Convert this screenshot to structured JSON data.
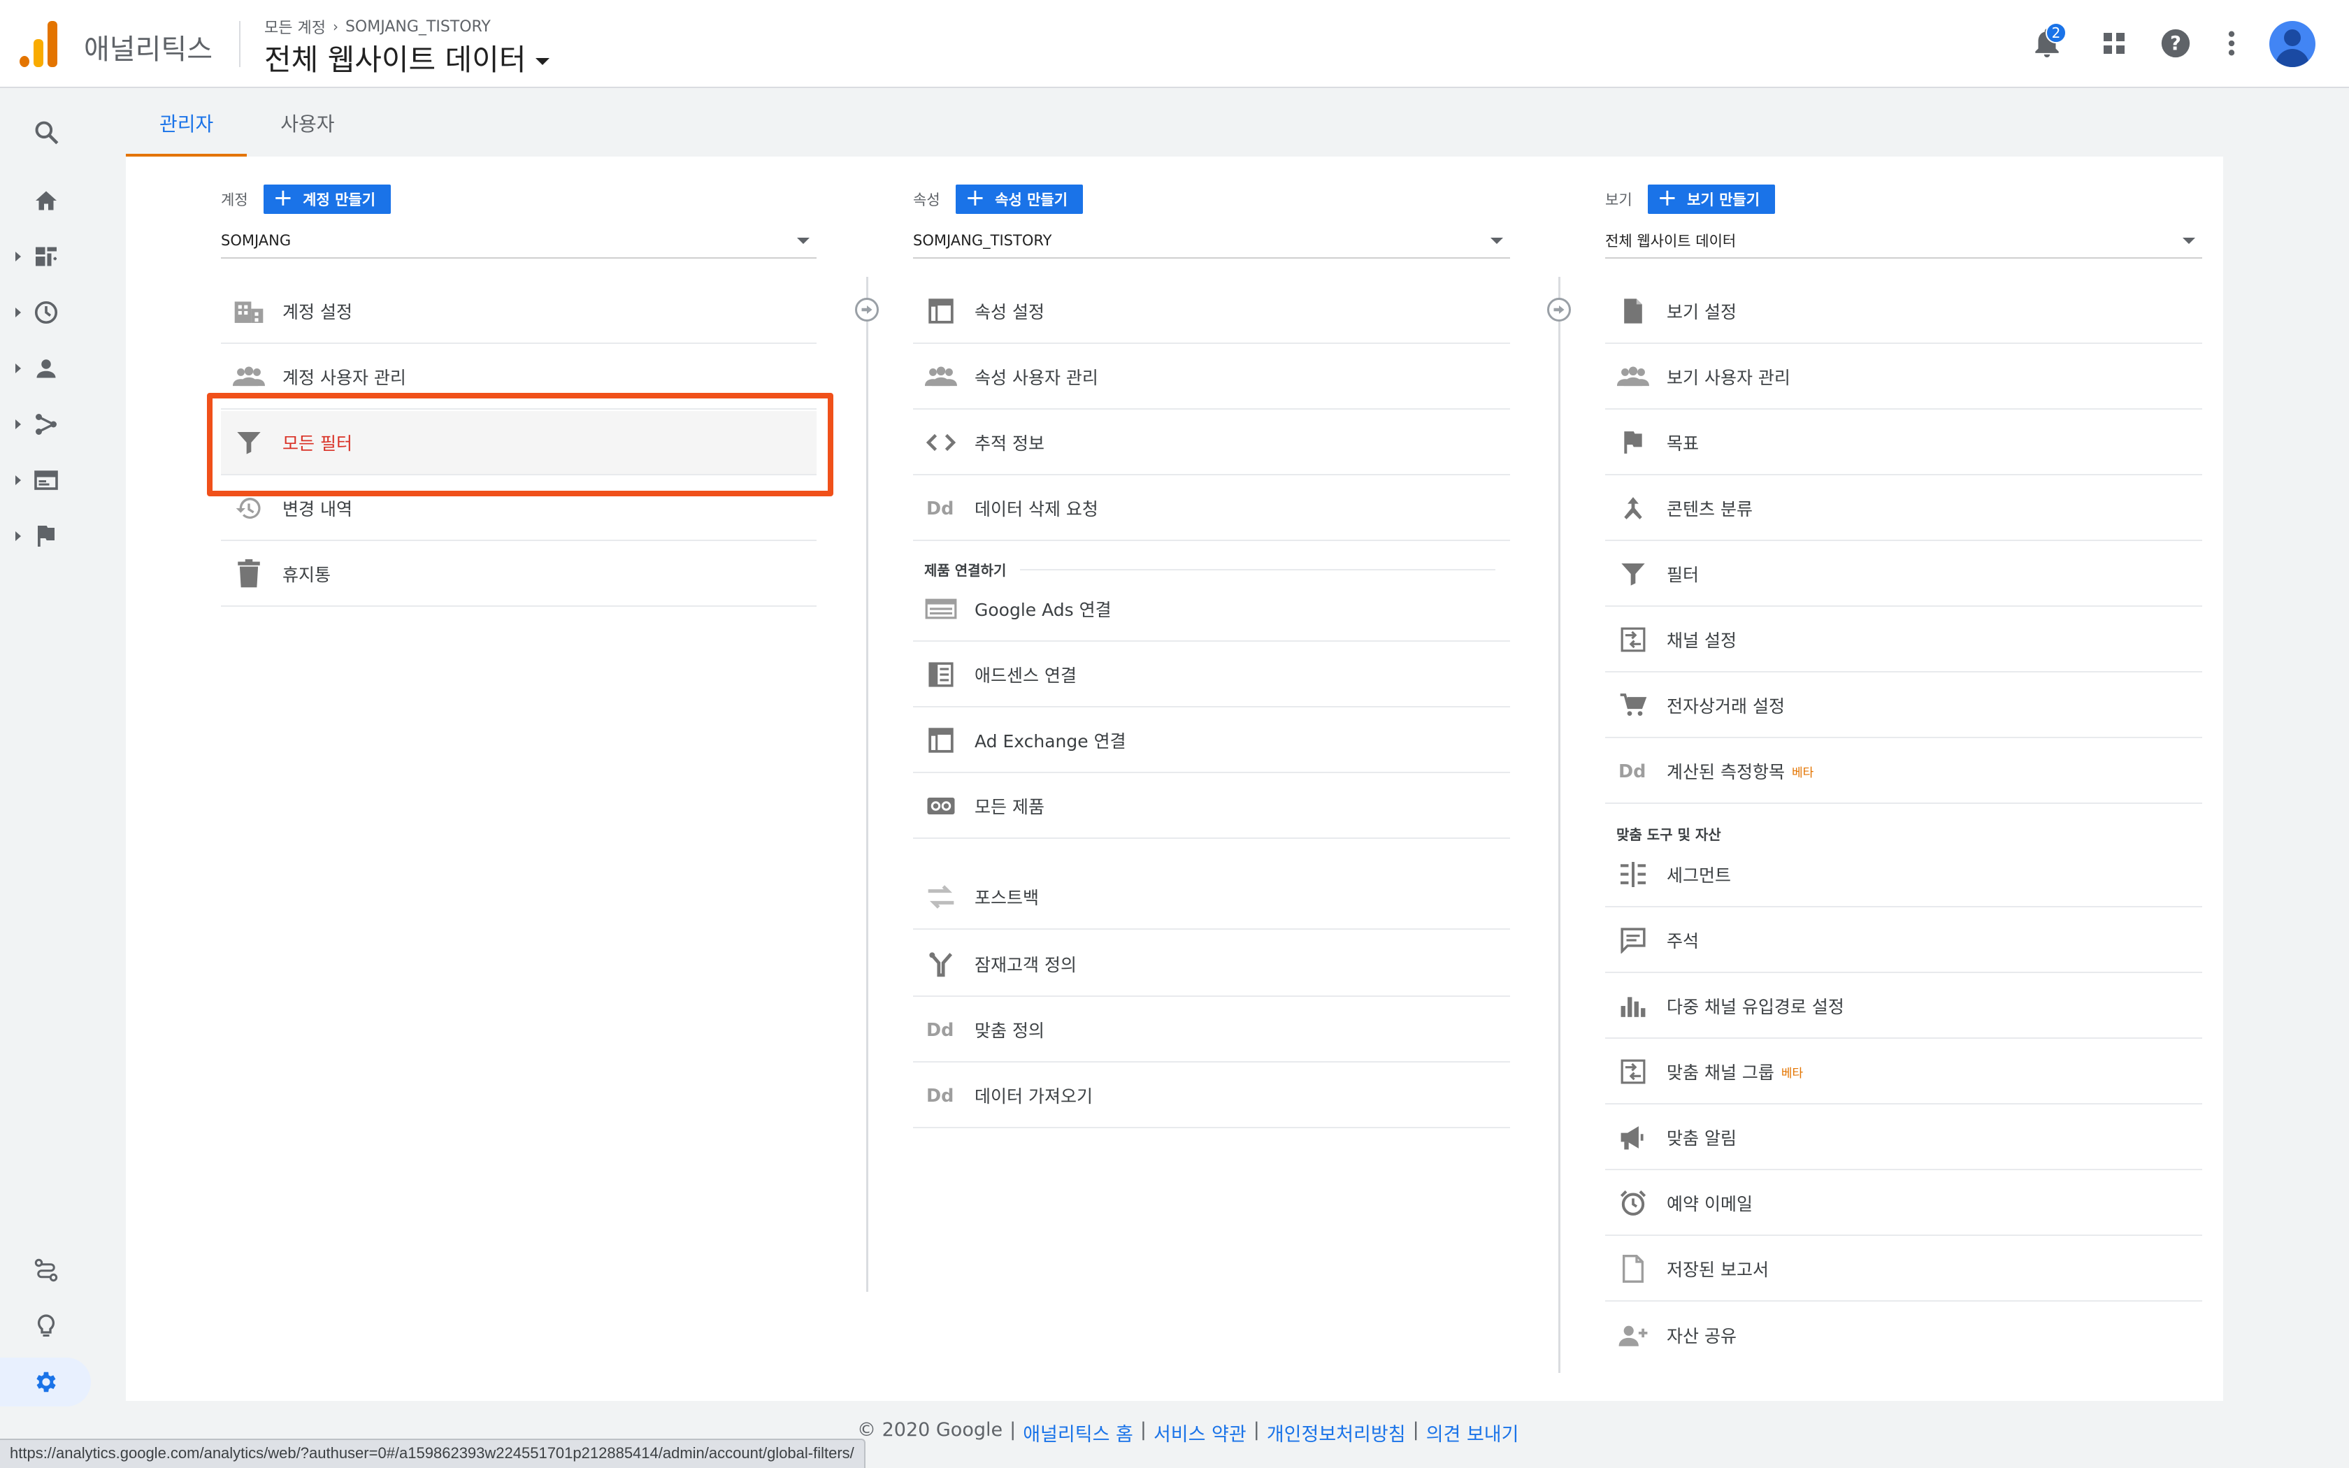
{
  "header": {
    "app_name": "애널리틱스",
    "breadcrumb_root": "모든 계정",
    "breadcrumb_account": "SOMJANG_TISTORY",
    "view_title": "전체 웹사이트 데이터",
    "notification_count": "2"
  },
  "tabs": [
    {
      "label": "관리자",
      "active": true
    },
    {
      "label": "사용자",
      "active": false
    }
  ],
  "account_col": {
    "label": "계정",
    "create_label": "계정 만들기",
    "selected": "SOMJANG",
    "items": [
      {
        "label": "계정 설정",
        "icon": "building-icon"
      },
      {
        "label": "계정 사용자 관리",
        "icon": "people-icon"
      },
      {
        "label": "모든 필터",
        "icon": "filter-icon",
        "selected": true
      },
      {
        "label": "변경 내역",
        "icon": "history-icon"
      },
      {
        "label": "휴지통",
        "icon": "trash-icon"
      }
    ]
  },
  "property_col": {
    "label": "속성",
    "create_label": "속성 만들기",
    "selected": "SOMJANG_TISTORY",
    "items": [
      {
        "label": "속성 설정",
        "icon": "window-icon"
      },
      {
        "label": "속성 사용자 관리",
        "icon": "people-icon"
      },
      {
        "label": "추적 정보",
        "icon": "code-icon"
      },
      {
        "label": "데이터 삭제 요청",
        "icon": "dd-icon"
      }
    ],
    "section_label": "제품 연결하기",
    "product_items": [
      {
        "label": "Google Ads 연결",
        "icon": "ads-icon"
      },
      {
        "label": "애드센스 연결",
        "icon": "adsense-icon"
      },
      {
        "label": "Ad Exchange 연결",
        "icon": "window-icon"
      },
      {
        "label": "모든 제품",
        "icon": "link-icon"
      }
    ],
    "other_items": [
      {
        "label": "포스트백",
        "icon": "postback-icon"
      },
      {
        "label": "잠재고객 정의",
        "icon": "audience-icon"
      },
      {
        "label": "맞춤 정의",
        "icon": "dd-icon"
      },
      {
        "label": "데이터 가져오기",
        "icon": "dd-icon"
      }
    ]
  },
  "view_col": {
    "label": "보기",
    "create_label": "보기 만들기",
    "selected": "전체 웹사이트 데이터",
    "items": [
      {
        "label": "보기 설정",
        "icon": "document-icon"
      },
      {
        "label": "보기 사용자 관리",
        "icon": "people-icon"
      },
      {
        "label": "목표",
        "icon": "flag-icon"
      },
      {
        "label": "콘텐츠 분류",
        "icon": "grouping-icon"
      },
      {
        "label": "필터",
        "icon": "filter-icon"
      },
      {
        "label": "채널 설정",
        "icon": "channel-icon"
      },
      {
        "label": "전자상거래 설정",
        "icon": "cart-icon"
      },
      {
        "label": "계산된 측정항목",
        "icon": "dd-icon",
        "beta": "베타"
      }
    ],
    "section_label": "맞춤 도구 및 자산",
    "tool_items": [
      {
        "label": "세그먼트",
        "icon": "segment-icon"
      },
      {
        "label": "주석",
        "icon": "comment-icon"
      },
      {
        "label": "다중 채널 유입경로 설정",
        "icon": "bar-chart-icon"
      },
      {
        "label": "맞춤 채널 그룹",
        "icon": "channel-icon",
        "beta": "베타"
      },
      {
        "label": "맞춤 알림",
        "icon": "megaphone-icon"
      },
      {
        "label": "예약 이메일",
        "icon": "alarm-icon"
      },
      {
        "label": "저장된 보고서",
        "icon": "report-icon"
      },
      {
        "label": "자산 공유",
        "icon": "share-user-icon"
      }
    ]
  },
  "footer": {
    "copyright": "© 2020 Google",
    "links": [
      "애널리틱스 홈",
      "서비스 약관",
      "개인정보처리방침",
      "의견 보내기"
    ],
    "separator": "|"
  },
  "status_url": "https://analytics.google.com/analytics/web/?authuser=0#/a159862393w224551701p212885414/admin/account/global-filters/",
  "colors": {
    "accent": "#1a73e8",
    "highlight": "#f0501a",
    "selected_text": "#d93025",
    "tab_underline": "#e37400"
  }
}
